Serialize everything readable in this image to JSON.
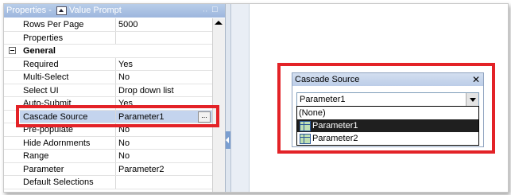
{
  "properties_panel": {
    "title": "Properties -",
    "object_type": "Value Prompt",
    "pin_glyph": "ᆢ",
    "close_glyph": "□",
    "rows": [
      {
        "name": "Rows Per Page",
        "value": "5000"
      },
      {
        "name": "Properties",
        "value": ""
      },
      {
        "name": "General",
        "value": "",
        "category": true
      },
      {
        "name": "Required",
        "value": "Yes"
      },
      {
        "name": "Multi-Select",
        "value": "No"
      },
      {
        "name": "Select UI",
        "value": "Drop down list"
      },
      {
        "name": "Auto-Submit",
        "value": "Yes"
      },
      {
        "name": "Cascade Source",
        "value": "Parameter1",
        "selected": true
      },
      {
        "name": "Pre-populate",
        "value": "No"
      },
      {
        "name": "Hide Adornments",
        "value": "No"
      },
      {
        "name": "Range",
        "value": "No"
      },
      {
        "name": "Parameter",
        "value": "Parameter2"
      },
      {
        "name": "Default Selections",
        "value": ""
      }
    ],
    "ellipsis_label": "..."
  },
  "cascade_dialog": {
    "title": "Cascade Source",
    "close_glyph": "✕",
    "selected_value": "Parameter1",
    "options": [
      {
        "label": "(None)",
        "icon": false,
        "highlighted": false
      },
      {
        "label": "Parameter1",
        "icon": true,
        "highlighted": true
      },
      {
        "label": "Parameter2",
        "icon": true,
        "highlighted": false
      }
    ]
  },
  "colors": {
    "highlight_box": "#e32227",
    "selected_row": "#c4d4ee"
  }
}
